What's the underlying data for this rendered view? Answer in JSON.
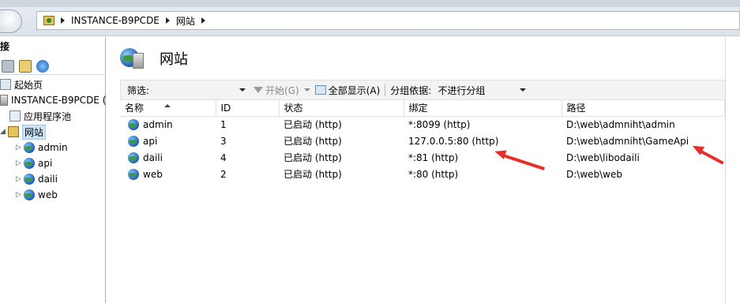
{
  "address": {
    "crumbs": [
      "INSTANCE-B9PCDE",
      "网站"
    ]
  },
  "left": {
    "header": "接",
    "tree": {
      "start_page": "起始页",
      "server": "INSTANCE-B9PCDE (",
      "app_pools": "应用程序池",
      "sites": "网站",
      "children": [
        "admin",
        "api",
        "daili",
        "web"
      ]
    }
  },
  "right": {
    "title": "网站",
    "filter": {
      "label": "筛选:",
      "go": "开始(G)",
      "show_all": "全部显示(A)",
      "group_by_label": "分组依据:",
      "group_by_value": "不进行分组"
    },
    "columns": [
      "名称",
      "ID",
      "状态",
      "绑定",
      "路径"
    ],
    "rows": [
      {
        "name": "admin",
        "id": "1",
        "status": "已启动 (http)",
        "binding": "*:8099 (http)",
        "path": "D:\\web\\admniht\\admin"
      },
      {
        "name": "api",
        "id": "3",
        "status": "已启动 (http)",
        "binding": "127.0.0.5:80 (http)",
        "path": "D:\\web\\admniht\\GameApi"
      },
      {
        "name": "daili",
        "id": "4",
        "status": "已启动 (http)",
        "binding": "*:81 (http)",
        "path": "D:\\web\\libodaili"
      },
      {
        "name": "web",
        "id": "2",
        "status": "已启动 (http)",
        "binding": "*:80 (http)",
        "path": "D:\\web\\web"
      }
    ]
  },
  "colors": {
    "annotation_arrow": "#e8302b",
    "selection": "#cce4f7"
  }
}
